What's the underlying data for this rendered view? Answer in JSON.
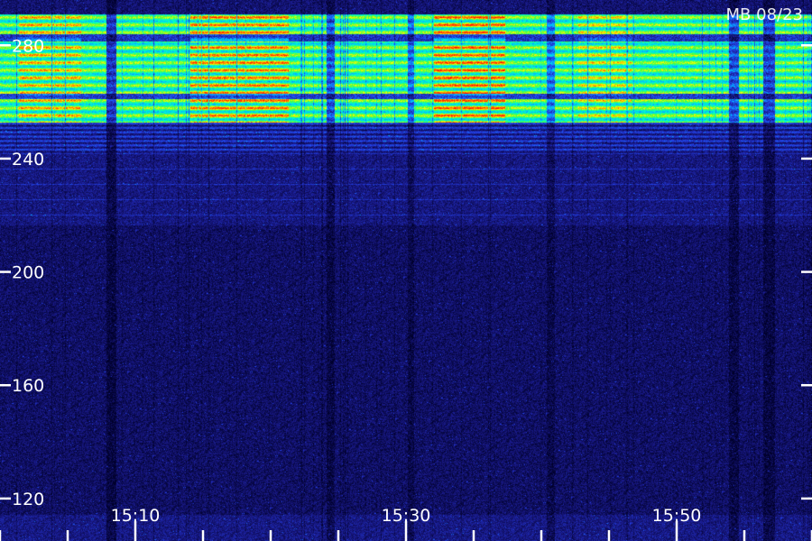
{
  "header": {
    "station_label": "MB 08/23"
  },
  "chart_data": {
    "type": "heatmap",
    "title": "",
    "xlabel": "",
    "ylabel": "",
    "x_tick_labels": [
      "15:10",
      "15:30",
      "15:50"
    ],
    "y_tick_labels": [
      "120",
      "160",
      "200",
      "240",
      "280"
    ],
    "y_ticks": [
      120,
      160,
      200,
      240,
      280
    ],
    "ylim": [
      105,
      296
    ],
    "x_range": [
      "15:00",
      "16:00"
    ],
    "colormap": [
      "#00002a",
      "#1a1a8a",
      "#2244ee",
      "#00bbff",
      "#00ffcc",
      "#44ff44",
      "#ffff00",
      "#ff6600",
      "#ff0000"
    ],
    "bands": [
      {
        "y_from": 253,
        "y_to": 291,
        "level": 0.62,
        "note": "strong emission band"
      },
      {
        "y_from": 243,
        "y_to": 253,
        "level": 0.22,
        "note": "weak band"
      }
    ]
  }
}
